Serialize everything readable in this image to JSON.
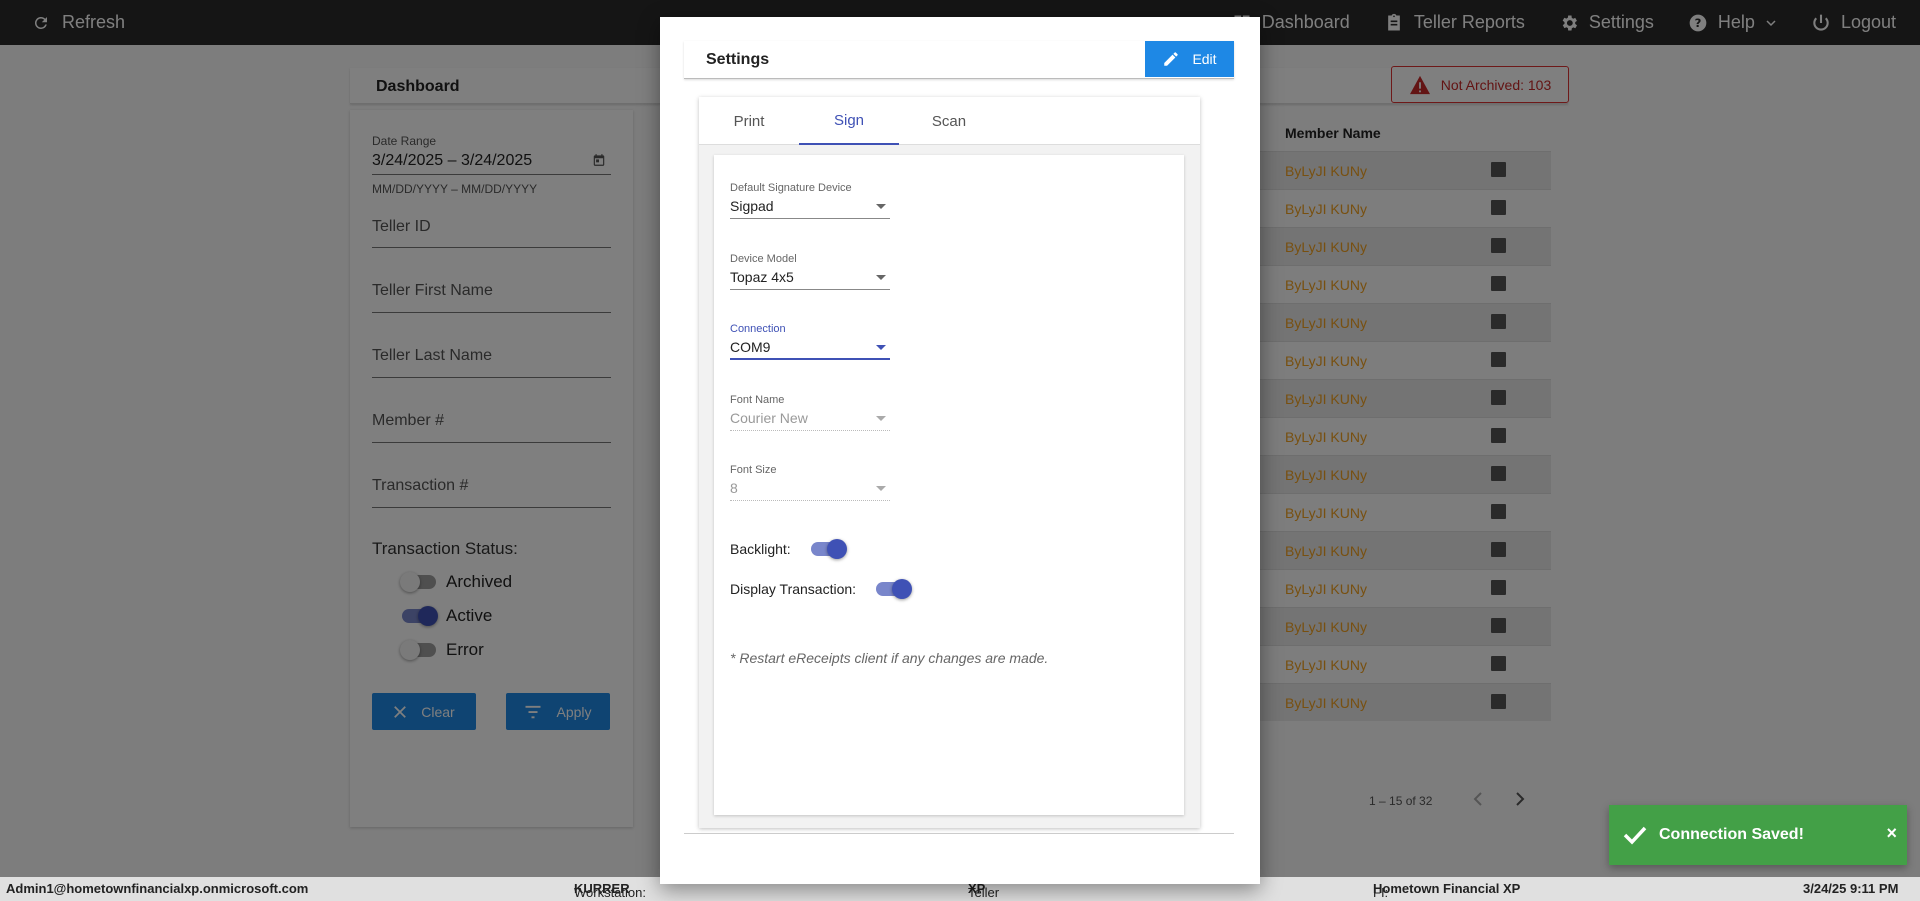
{
  "topbar": {
    "refresh_label": "Refresh",
    "nav": {
      "dashboard": "Dashboard",
      "teller_reports": "Teller Reports",
      "settings": "Settings",
      "help": "Help",
      "logout": "Logout"
    }
  },
  "dashboard": {
    "title": "Dashboard",
    "not_archived": "Not Archived: 103",
    "filters": {
      "date_range_label": "Date Range",
      "date_range_value": "3/24/2025 – 3/24/2025",
      "date_hint": "MM/DD/YYYY – MM/DD/YYYY",
      "teller_id": "Teller ID",
      "teller_first_name": "Teller First Name",
      "teller_last_name": "Teller Last Name",
      "member_no": "Member #",
      "transaction_no": "Transaction #",
      "status_title": "Transaction Status:",
      "archived": "Archived",
      "active": "Active",
      "error": "Error",
      "archived_on": false,
      "active_on": true,
      "error_on": false,
      "clear": "Clear",
      "apply": "Apply"
    },
    "table": {
      "header": "Member Name",
      "rows": [
        "ByLyJI KUNy",
        "ByLyJI KUNy",
        "ByLyJI KUNy",
        "ByLyJI KUNy",
        "ByLyJI KUNy",
        "ByLyJI KUNy",
        "ByLyJI KUNy",
        "ByLyJI KUNy",
        "ByLyJI KUNy",
        "ByLyJI KUNy",
        "ByLyJI KUNy",
        "ByLyJI KUNy",
        "ByLyJI KUNy",
        "ByLyJI KUNy",
        "ByLyJI KUNy"
      ]
    },
    "pager": "1 – 15 of 32"
  },
  "modal": {
    "title": "Settings",
    "edit": "Edit",
    "tabs": [
      "Print",
      "Sign",
      "Scan"
    ],
    "active_tab": "Sign",
    "default_signature_device": {
      "label": "Default Signature Device",
      "value": "Sigpad"
    },
    "device_model": {
      "label": "Device Model",
      "value": "Topaz 4x5"
    },
    "connection": {
      "label": "Connection",
      "value": "COM9"
    },
    "font_name": {
      "label": "Font Name",
      "value": "Courier New"
    },
    "font_size": {
      "label": "Font Size",
      "value": "8"
    },
    "backlight": {
      "label": "Backlight:",
      "on": true
    },
    "display_transaction": {
      "label": "Display Transaction:",
      "on": true
    },
    "note": "* Restart eReceipts client if any changes are made."
  },
  "toast": {
    "message": "Connection Saved!",
    "close": "×"
  },
  "statusbar": {
    "user": "Admin1@hometownfinancialxp.onmicrosoft.com",
    "workstation_label": "Workstation:",
    "workstation": "KURRER",
    "platform_label": "Teller Platform:",
    "platform": "XP",
    "fi_label": "FI:",
    "fi": "Hometown Financial XP",
    "datetime": "3/24/25 9:11 PM"
  },
  "colors": {
    "accent": "#3f51b5",
    "primary_button": "#1e88e5",
    "member_name": "#f0a020",
    "toast": "#43a047",
    "alert": "#c62828"
  }
}
